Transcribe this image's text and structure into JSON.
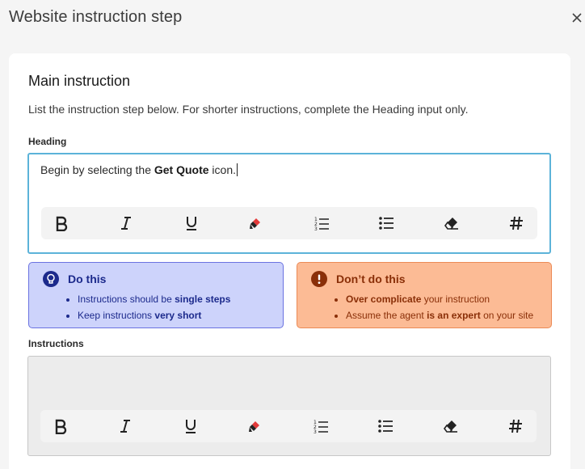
{
  "dialog": {
    "title": "Website instruction step",
    "close_icon": "close-icon"
  },
  "section": {
    "title": "Main instruction",
    "description": "List the instruction step below. For shorter instructions, complete the Heading input only."
  },
  "heading": {
    "label": "Heading",
    "text_before": "Begin by selecting the ",
    "text_bold": "Get Quote",
    "text_after": " icon."
  },
  "toolbar": {
    "buttons": [
      "bold-icon",
      "italic-icon",
      "underline-icon",
      "highlighter-icon",
      "ordered-list-icon",
      "bullet-list-icon",
      "eraser-icon",
      "hashtag-icon"
    ]
  },
  "do_tip": {
    "title": "Do this",
    "items": [
      {
        "before": "Instructions should be ",
        "bold": "single steps",
        "after": ""
      },
      {
        "before": "Keep instructions ",
        "bold": "very short",
        "after": ""
      }
    ],
    "color_bg": "#cdd3fb",
    "color_text": "#1c2a8c"
  },
  "dont_tip": {
    "title": "Don’t do this",
    "items": [
      {
        "before": "",
        "bold": "Over complicate",
        "after": " your instruction"
      },
      {
        "before": "Assume the agent ",
        "bold": "is an expert",
        "after": " on your site"
      }
    ],
    "color_bg": "#fcbb95",
    "color_text": "#8a2f08"
  },
  "instructions": {
    "label": "Instructions",
    "value": ""
  }
}
